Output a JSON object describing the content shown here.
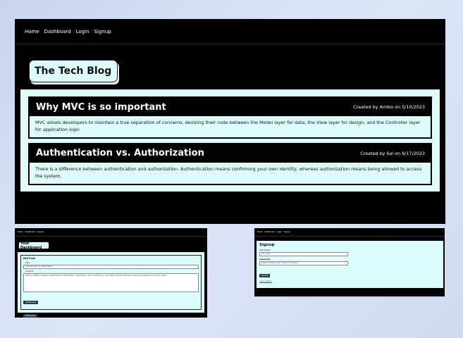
{
  "main": {
    "nav": [
      "Home",
      "Dashboard",
      "Login",
      "Signup"
    ],
    "hero_title": "The Tech Blog",
    "posts": [
      {
        "title": "Why MVC is so important",
        "meta": "Created by Amiko on 5/10/2023",
        "body": "MVC allows developers to maintain a true separation of concerns, devising their code between the Model layer for data, the View layer for design, and the Controller layer for application logic."
      },
      {
        "title": "Authentication vs. Authorization",
        "meta": "Created by Sal on 6/17/2023",
        "body": "There is a difference between authentication and authorization. Authentication means confirming your own identity, whereas authorization means being allowed to access the system."
      }
    ]
  },
  "dashboard": {
    "nav": [
      "Home",
      "Dashboard",
      "Logout"
    ],
    "title": "Your Dashboard",
    "panel_title": "Edit Post:",
    "title_label": "Title",
    "title_value": "Authentication vs. Authorization",
    "content_label": "Content",
    "content_value": "There is a difference between authentication and authorization. Authentication means confirming your own identity, whereas authorization means being allowed to access the system.",
    "update_btn": "Update post",
    "delete_btn": "Delete post"
  },
  "signup": {
    "nav": [
      "Home",
      "Dashboard",
      "Login",
      "Signup"
    ],
    "title": "Signup",
    "username_label": "User Name",
    "username_placeholder": "Your name",
    "password_label": "password",
    "password_placeholder": "Create a password (8+ chars & characters)",
    "submit_btn": "Submit",
    "login_link": "Login instead"
  }
}
